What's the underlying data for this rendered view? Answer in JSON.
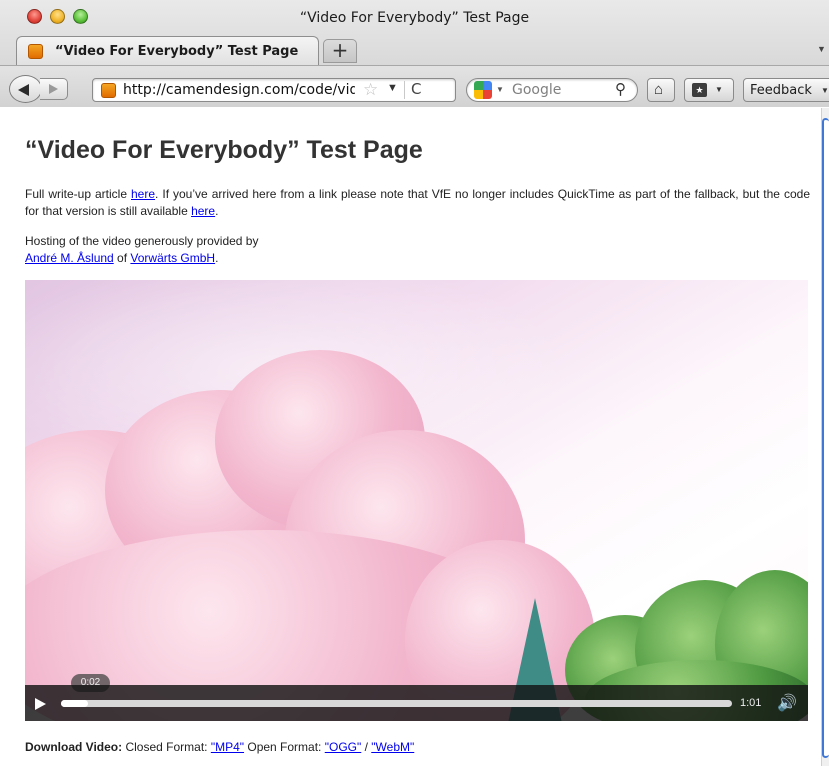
{
  "window": {
    "title": "“Video For Everybody” Test Page"
  },
  "tabs": [
    {
      "label": "“Video For Everybody” Test Page"
    }
  ],
  "newtab_label": "+",
  "navbar": {
    "url": "http://camendesign.com/code/video_for_everybody/test.html",
    "search_placeholder": "Google",
    "feedback_label": "Feedback"
  },
  "page": {
    "heading": "“Video For Everybody” Test Page",
    "p1_a": "Full write-up article ",
    "p1_link1": "here",
    "p1_b": ". If you’ve arrived here from a link please note that VfE no longer includes QuickTime as part of the fallback, but the code for that version is still available ",
    "p1_link2": "here",
    "p1_c": ".",
    "p2_a": "Hosting of the video generously provided by",
    "p2_link1": "André M. Åslund",
    "p2_b": " of ",
    "p2_link2": "Vorwärts GmbH",
    "p2_c": "."
  },
  "video": {
    "current_time": "0:02",
    "duration": "1:01",
    "progress_fraction": 0.04
  },
  "download": {
    "label": "Download Video:",
    "closed_text": " Closed Format: ",
    "mp4_link": "\"MP4\"",
    "open_text": " Open Format: ",
    "ogg_link": "\"OGG\"",
    "slash": " / ",
    "webm_link": "\"WebM\""
  },
  "colors": {
    "link": "#0000ee",
    "scroll_accent": "#3f78d6"
  }
}
